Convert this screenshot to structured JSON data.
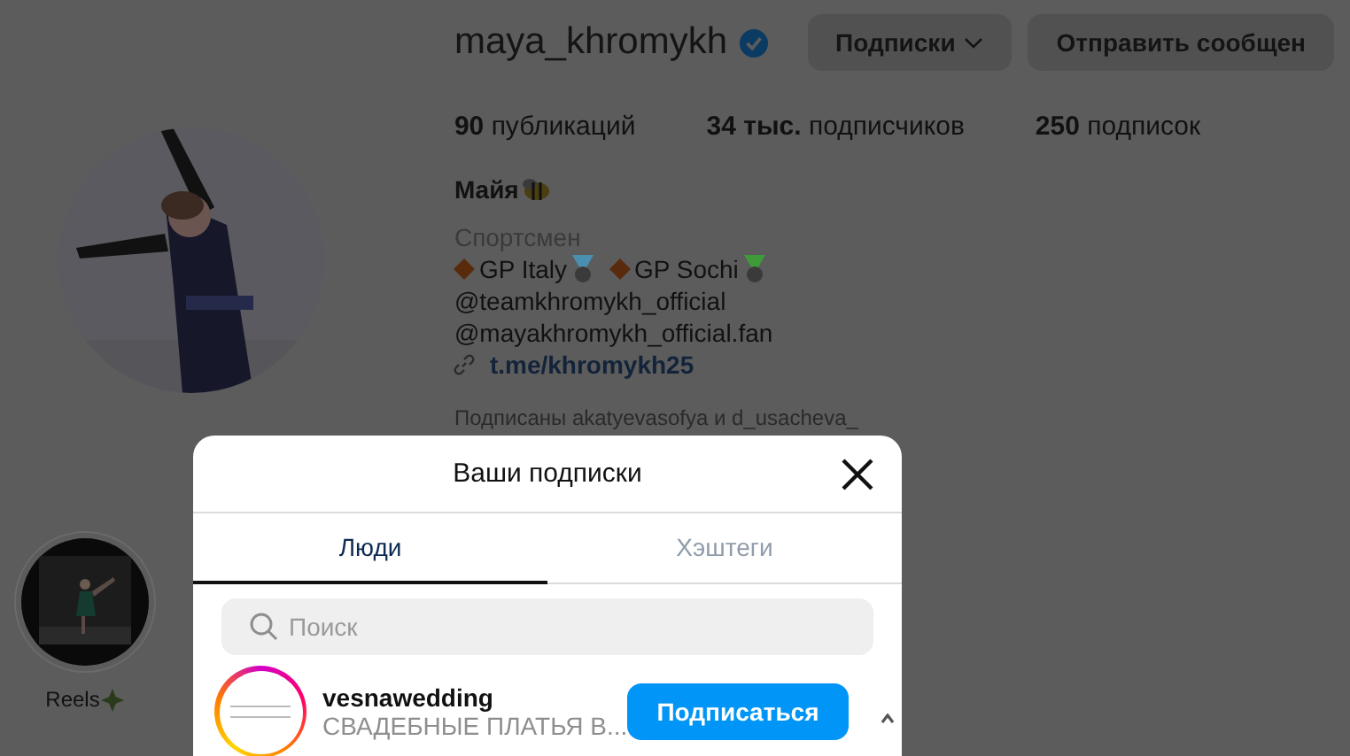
{
  "profile": {
    "username": "maya_khromykh",
    "verified": true,
    "buttons": [
      {
        "label": "Подписки",
        "kind": "dropdown"
      },
      {
        "label": "Отправить сообщен",
        "kind": "plain"
      }
    ],
    "stats": [
      {
        "number": "90",
        "label": "публикаций"
      },
      {
        "number": "34 тыс.",
        "label": "подписчиков"
      },
      {
        "number": "250",
        "label": "подписок"
      }
    ],
    "name": "Майя",
    "category": "Спортсмен",
    "achievements": [
      {
        "label": "GP Italy",
        "color": "#4a8fb0"
      },
      {
        "label": "GP Sochi",
        "color": "#3f9a3a"
      }
    ],
    "bio_lines": [
      "@teamkhromykh_official",
      "@mayakhromykh_official.fan"
    ],
    "link": "t.me/khromykh25",
    "followed_by": "Подписаны akatyevasofya и d_usacheva_"
  },
  "highlights": [
    {
      "label": "Reels"
    }
  ],
  "modal": {
    "title": "Ваши подписки",
    "tabs": [
      {
        "label": "Люди",
        "selected": true
      },
      {
        "label": "Хэштеги",
        "selected": false
      }
    ],
    "search": {
      "placeholder": "Поиск"
    },
    "accounts": [
      {
        "username": "vesnawedding",
        "subtitle": "СВАДЕБНЫЕ ПЛАТЬЯ В...",
        "button": "Подписаться",
        "story_ring": true
      }
    ]
  }
}
